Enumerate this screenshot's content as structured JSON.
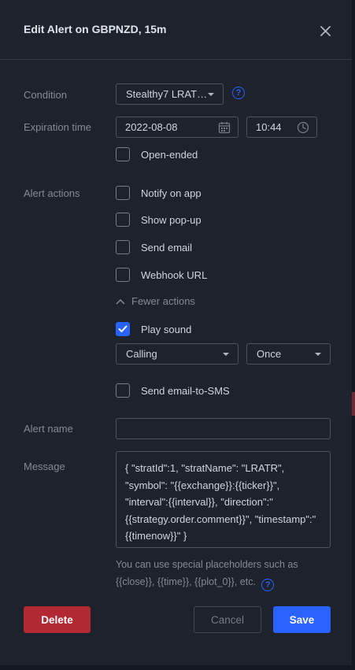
{
  "dialog": {
    "title": "Edit Alert on GBPNZD, 15m"
  },
  "condition": {
    "label": "Condition",
    "value": "Stealthy7 LRAT…"
  },
  "expiration": {
    "label": "Expiration time",
    "date": "2022-08-08",
    "time": "10:44",
    "open_ended_label": "Open-ended",
    "open_ended_checked": false
  },
  "alert_actions": {
    "label": "Alert actions",
    "notify_on_app": "Notify on app",
    "show_popup": "Show pop-up",
    "send_email": "Send email",
    "webhook_url": "Webhook URL",
    "fewer_actions": "Fewer actions",
    "play_sound": "Play sound",
    "play_sound_checked": true,
    "sound_name": "Calling",
    "sound_repeat": "Once",
    "send_email_to_sms": "Send email-to-SMS"
  },
  "alert_name": {
    "label": "Alert name",
    "value": ""
  },
  "message": {
    "label": "Message",
    "value": "{ \"stratId\":1, \"stratName\": \"LRATR\", \"symbol\": \"{{exchange}}:{{ticker}}\", \"interval\":{{interval}}, \"direction\":\"{{strategy.order.comment}}\", \"timestamp\":\"{{timenow}}\" }",
    "hint": "You can use special placeholders such as {{close}}, {{time}}, {{plot_0}}, etc."
  },
  "buttons": {
    "delete": "Delete",
    "cancel": "Cancel",
    "save": "Save"
  },
  "colors": {
    "accent": "#2962ff",
    "danger": "#b22833",
    "background": "#1e222d"
  },
  "icons": {
    "close": "close-icon",
    "calendar": "calendar-icon",
    "clock": "clock-icon",
    "help": "help-icon",
    "chevron_up": "chevron-up-icon",
    "check": "check-icon"
  }
}
